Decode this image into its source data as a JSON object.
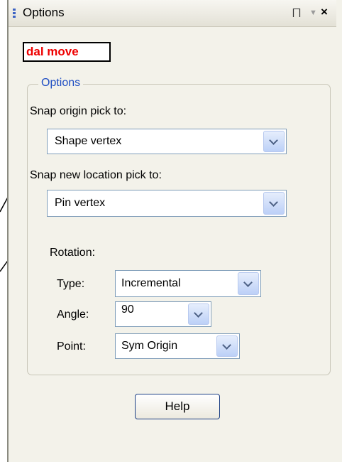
{
  "panel": {
    "title": "Options",
    "pin_glyph": "⨅",
    "dropdown_glyph": "▼",
    "close_glyph": "×"
  },
  "command": {
    "name": "dal move"
  },
  "options_group": {
    "legend": "Options",
    "snap_origin": {
      "label": "Snap origin pick to:",
      "value": "Shape vertex"
    },
    "snap_new": {
      "label": "Snap new location pick to:",
      "value": "Pin vertex"
    },
    "rotation": {
      "label": "Rotation:",
      "type": {
        "label": "Type:",
        "value": "Incremental"
      },
      "angle": {
        "label": "Angle:",
        "value": "90"
      },
      "point": {
        "label": "Point:",
        "value": "Sym Origin"
      }
    }
  },
  "help_button": {
    "label": "Help"
  },
  "colors": {
    "accent": "#1f4ec3",
    "command_text": "#ee0000",
    "panel_bg": "#f3f2ea"
  }
}
